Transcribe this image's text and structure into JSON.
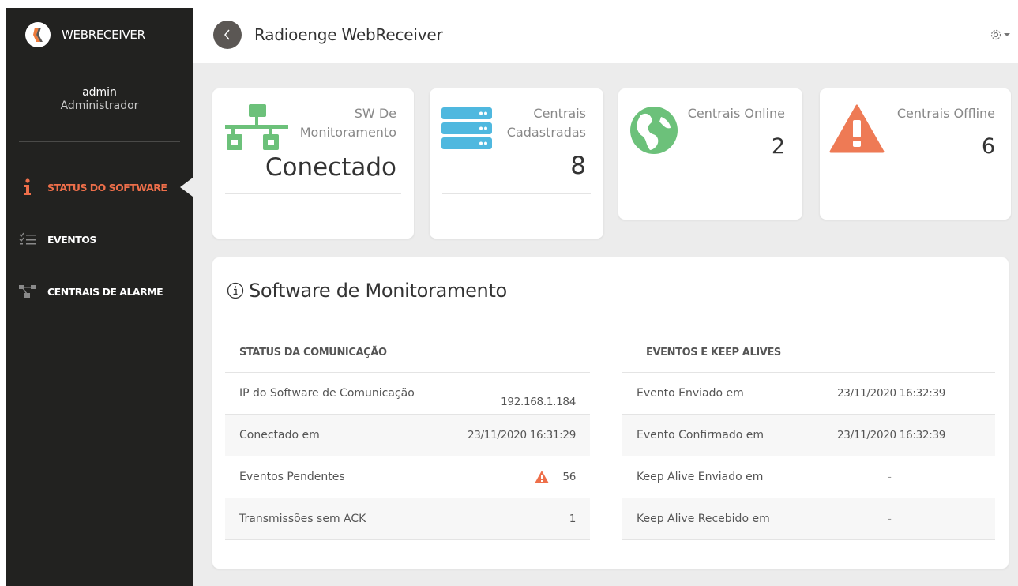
{
  "sidebar": {
    "brand": "WEBRECEIVER",
    "user_name": "admin",
    "user_role": "Administrador",
    "items": [
      {
        "label": "STATUS DO SOFTWARE",
        "icon": "info-icon",
        "active": true
      },
      {
        "label": "EVENTOS",
        "icon": "checklist-icon",
        "active": false
      },
      {
        "label": "CENTRAIS DE ALARME",
        "icon": "network-icon",
        "active": false
      }
    ]
  },
  "header": {
    "title": "Radioenge WebReceiver",
    "back_icon": "chevron-left-icon",
    "settings_icon": "gear-icon"
  },
  "cards": [
    {
      "title": "SW De\nMonitoramento",
      "value": "Conectado",
      "icon": "network-icon",
      "color": "#6cc17a"
    },
    {
      "title": "Centrais\nCadastradas",
      "value": "8",
      "icon": "server-icon",
      "color": "#4fb8df"
    },
    {
      "title": "Centrais Online",
      "value": "2",
      "icon": "globe-icon",
      "color": "#6cc17a"
    },
    {
      "title": "Centrais Offline",
      "value": "6",
      "icon": "warning-icon",
      "color": "#ee7a55"
    }
  ],
  "panel": {
    "title": "Software de Monitoramento",
    "left": {
      "heading": "STATUS DA COMUNICAÇÃO",
      "rows": [
        {
          "label": "IP do Software de Comunicação",
          "value": "192.168.1.184"
        },
        {
          "label": "Conectado em",
          "value": "23/11/2020 16:31:29"
        },
        {
          "label": "Eventos Pendentes",
          "value": "56"
        },
        {
          "label": "Transmissões sem ACK",
          "value": "1"
        }
      ]
    },
    "right": {
      "heading": "EVENTOS E KEEP ALIVES",
      "rows": [
        {
          "label": "Evento Enviado em",
          "value": "23/11/2020 16:32:39"
        },
        {
          "label": "Evento Confirmado em",
          "value": "23/11/2020 16:32:39"
        },
        {
          "label": "Keep Alive Enviado em",
          "value": "-"
        },
        {
          "label": "Keep Alive Recebido em",
          "value": "-"
        }
      ]
    }
  },
  "colors": {
    "sidebar_bg": "#222220",
    "accent": "#ee6f4a",
    "green": "#6cc17a",
    "blue": "#4fb8df",
    "content_bg": "#ececec"
  }
}
